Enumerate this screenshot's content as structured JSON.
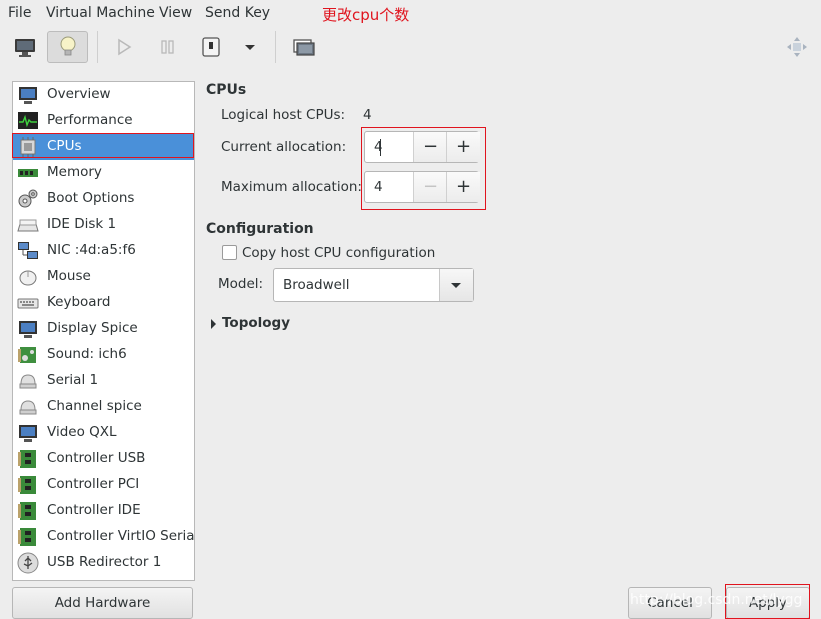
{
  "menubar": {
    "file": "File",
    "vm": "Virtual Machine",
    "view": "View",
    "sendkey": "Send Key",
    "annotation": "更改cpu个数"
  },
  "toolbar": {
    "icons": [
      "monitor-icon",
      "lightbulb-icon",
      "play-icon",
      "pause-icon",
      "shutdown-icon",
      "dropdown-icon",
      "screenshot-icon",
      "fullscreen-icon"
    ]
  },
  "sidebar": {
    "items": [
      {
        "label": "Overview",
        "icon": "overview-icon"
      },
      {
        "label": "Performance",
        "icon": "performance-icon"
      },
      {
        "label": "CPUs",
        "icon": "cpu-icon"
      },
      {
        "label": "Memory",
        "icon": "memory-icon"
      },
      {
        "label": "Boot Options",
        "icon": "gears-icon"
      },
      {
        "label": "IDE Disk 1",
        "icon": "disk-icon"
      },
      {
        "label": "NIC :4d:a5:f6",
        "icon": "network-icon"
      },
      {
        "label": "Mouse",
        "icon": "mouse-icon"
      },
      {
        "label": "Keyboard",
        "icon": "keyboard-icon"
      },
      {
        "label": "Display Spice",
        "icon": "display-icon"
      },
      {
        "label": "Sound: ich6",
        "icon": "sound-icon"
      },
      {
        "label": "Serial 1",
        "icon": "serial-icon"
      },
      {
        "label": "Channel spice",
        "icon": "channel-icon"
      },
      {
        "label": "Video QXL",
        "icon": "video-icon"
      },
      {
        "label": "Controller USB",
        "icon": "controller-icon"
      },
      {
        "label": "Controller PCI",
        "icon": "controller-icon"
      },
      {
        "label": "Controller IDE",
        "icon": "controller-icon"
      },
      {
        "label": "Controller VirtIO Serial",
        "icon": "controller-icon"
      },
      {
        "label": "USB Redirector 1",
        "icon": "usb-icon"
      }
    ],
    "selected": "CPUs",
    "add_hardware": "Add Hardware"
  },
  "cpus": {
    "section": "CPUs",
    "logical_label": "Logical host CPUs:",
    "logical_value": "4",
    "current_label": "Current allocation:",
    "current_value": "4",
    "max_label": "Maximum allocation:",
    "max_value": "4",
    "minus": "−",
    "plus": "+"
  },
  "configuration": {
    "section": "Configuration",
    "copy_host": "Copy host CPU configuration",
    "copy_host_checked": false,
    "model_label": "Model:",
    "model_value": "Broadwell"
  },
  "topology": {
    "label": "Topology",
    "expanded": false
  },
  "buttons": {
    "cancel": "Cancel",
    "apply": "Apply"
  },
  "watermark": "http://blog.csdn.net/lygg",
  "colors": {
    "selection": "#4a90d9",
    "annotation_red": "#e0141e"
  }
}
